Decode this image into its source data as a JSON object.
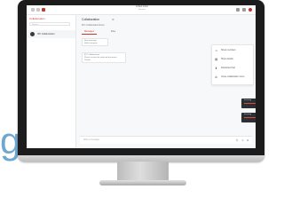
{
  "decor": {
    "partial_letter": "g"
  },
  "app": {
    "window_title": "Unified Admin",
    "window_subtitle": "Signed in"
  },
  "sidebar": {
    "title": "Collaboration",
    "search_placeholder": "Search",
    "items": [
      {
        "label": "IPC Collaboration"
      }
    ]
  },
  "chat": {
    "title": "Collaboration",
    "subtitle": "IPC Collaboration Room",
    "tabs": [
      {
        "label": "Messages"
      },
      {
        "label": "Files"
      }
    ],
    "messages": [
      {
        "lines": [
          "New message",
          "Hello everyone"
        ]
      },
      {
        "lines": [
          "IPC Collaboration",
          "Please review the attached document",
          "Thanks"
        ]
      }
    ],
    "composer_placeholder": "Write a message",
    "cards": [
      {
        "label": "Incoming"
      },
      {
        "label": "Incoming"
      }
    ]
  },
  "menu": {
    "items": [
      {
        "label": "Show members",
        "icon": "people-icon"
      },
      {
        "label": "Show details",
        "icon": "document-icon"
      },
      {
        "label": "Download chat",
        "icon": "download-icon"
      },
      {
        "label": "Close collaboration room",
        "icon": "close-circle-icon"
      }
    ]
  },
  "colors": {
    "accent": "#c0392b",
    "card_bg": "#2b3034",
    "card_line": "#d84a3a",
    "monitor_bezel": "#1c1c1c",
    "brand_blue": "#6fa8cf"
  }
}
